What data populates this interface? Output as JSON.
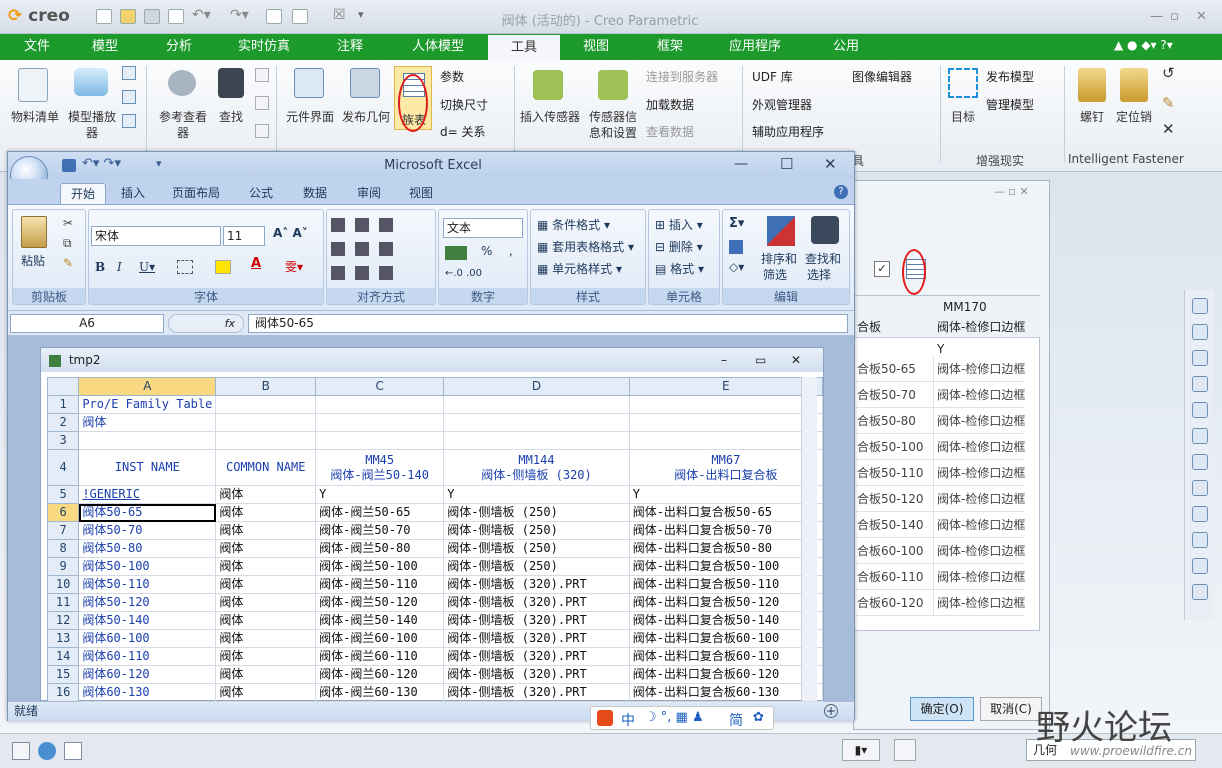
{
  "creo": {
    "logo": "creo",
    "window_title": "阀体 (活动的) - Creo Parametric",
    "tabs": [
      "文件",
      "模型",
      "分析",
      "实时仿真",
      "注释",
      "人体模型",
      "工具",
      "视图",
      "框架",
      "应用程序",
      "公用"
    ],
    "ribbon": {
      "bom": "物料清单",
      "model_player_1": "模型播放",
      "model_player_2": "器",
      "ref_viewer_1": "参考查看",
      "ref_viewer_2": "器",
      "find": "查找",
      "comp_interface": "元件界面",
      "publish_geom": "发布几何",
      "table": "族表",
      "params": "参数",
      "switch_dims": "切换尺寸",
      "relations": "d= 关系",
      "insert_sensor": "插入传感器",
      "sensor_info_1": "传感器信",
      "sensor_info_2": "息和设置",
      "connect_server": "连接到服务器",
      "load_data": "加载数据",
      "view_data": "查看数据",
      "udf_lib": "UDF 库",
      "appearance_mgr": "外观管理器",
      "aux_app": "辅助应用程序",
      "image_editor": "图像编辑器",
      "target": "目标",
      "publish_model": "发布模型",
      "manage_model": "管理模型",
      "ar_group": "增强现实",
      "bolt": "螺钉",
      "locate_pin": "定位销",
      "fastener_group": "Intelligent Fastener",
      "tool_group": "具"
    },
    "dialog": {
      "col1_partial": "合板",
      "col2_title": "MM170",
      "col2_sub": "阀体-检修口边框",
      "generic_val": "Y",
      "rows": [
        [
          "合板50-65",
          "阀体-检修口边框"
        ],
        [
          "合板50-70",
          "阀体-检修口边框"
        ],
        [
          "合板50-80",
          "阀体-检修口边框"
        ],
        [
          "合板50-100",
          "阀体-检修口边框"
        ],
        [
          "合板50-110",
          "阀体-检修口边框"
        ],
        [
          "合板50-120",
          "阀体-检修口边框"
        ],
        [
          "合板50-140",
          "阀体-检修口边框"
        ],
        [
          "合板60-100",
          "阀体-检修口边框"
        ],
        [
          "合板60-110",
          "阀体-检修口边框"
        ],
        [
          "合板60-120",
          "阀体-检修口边框"
        ]
      ],
      "ok": "确定(O)",
      "cancel": "取消(C)"
    },
    "status_right": "几何"
  },
  "excel": {
    "title": "Microsoft Excel",
    "tabs": [
      "开始",
      "插入",
      "页面布局",
      "公式",
      "数据",
      "审阅",
      "视图"
    ],
    "ribbon": {
      "paste": "粘贴",
      "clipboard": "剪贴板",
      "font_name": "宋体",
      "font_size": "11",
      "font_group": "字体",
      "align_group": "对齐方式",
      "number_format": "文本",
      "number_group": "数字",
      "cond_format": "条件格式",
      "table_format": "套用表格格式",
      "cell_style": "单元格样式",
      "style_group": "样式",
      "insert": "插入",
      "delete": "删除",
      "format": "格式",
      "cells_group": "单元格",
      "sort_1": "排序和",
      "sort_2": "筛选",
      "find_1": "查找和",
      "find_2": "选择",
      "edit_group": "编辑",
      "currency": "%"
    },
    "name_box": "A6",
    "formula": "阀体50-65",
    "status": "就绪",
    "sheet_title": "tmp2",
    "columns": [
      "A",
      "B",
      "C",
      "D",
      "E"
    ],
    "rows": [
      {
        "n": "1",
        "cells": [
          "Pro/E Family Table",
          "",
          "",
          "",
          ""
        ]
      },
      {
        "n": "2",
        "cells": [
          "阀体",
          "",
          "",
          "",
          ""
        ]
      },
      {
        "n": "3",
        "cells": [
          "",
          "",
          "",
          "",
          ""
        ]
      },
      {
        "n": "4",
        "cells": [
          "INST NAME",
          "COMMON NAME",
          "MM45\n阀体-阀兰50-140",
          "MM144\n阀体-侧墙板 (320)",
          "MM67\n阀体-出料口复合板"
        ]
      },
      {
        "n": "5",
        "cells": [
          "!GENERIC",
          "阀体",
          "Y",
          "Y",
          "Y"
        ]
      },
      {
        "n": "6",
        "cells": [
          "阀体50-65",
          "阀体",
          "阀体-阀兰50-65",
          "阀体-侧墙板 (250)",
          "阀体-出料口复合板50-65"
        ]
      },
      {
        "n": "7",
        "cells": [
          "阀体50-70",
          "阀体",
          "阀体-阀兰50-70",
          "阀体-侧墙板 (250)",
          "阀体-出料口复合板50-70"
        ]
      },
      {
        "n": "8",
        "cells": [
          "阀体50-80",
          "阀体",
          "阀体-阀兰50-80",
          "阀体-侧墙板 (250)",
          "阀体-出料口复合板50-80"
        ]
      },
      {
        "n": "9",
        "cells": [
          "阀体50-100",
          "阀体",
          "阀体-阀兰50-100",
          "阀体-侧墙板 (250)",
          "阀体-出料口复合板50-100"
        ]
      },
      {
        "n": "10",
        "cells": [
          "阀体50-110",
          "阀体",
          "阀体-阀兰50-110",
          "阀体-侧墙板 (320).PRT",
          "阀体-出料口复合板50-110"
        ]
      },
      {
        "n": "11",
        "cells": [
          "阀体50-120",
          "阀体",
          "阀体-阀兰50-120",
          "阀体-侧墙板 (320).PRT",
          "阀体-出料口复合板50-120"
        ]
      },
      {
        "n": "12",
        "cells": [
          "阀体50-140",
          "阀体",
          "阀体-阀兰50-140",
          "阀体-侧墙板 (320).PRT",
          "阀体-出料口复合板50-140"
        ]
      },
      {
        "n": "13",
        "cells": [
          "阀体60-100",
          "阀体",
          "阀体-阀兰60-100",
          "阀体-侧墙板 (320).PRT",
          "阀体-出料口复合板60-100"
        ]
      },
      {
        "n": "14",
        "cells": [
          "阀体60-110",
          "阀体",
          "阀体-阀兰60-110",
          "阀体-侧墙板 (320).PRT",
          "阀体-出料口复合板60-110"
        ]
      },
      {
        "n": "15",
        "cells": [
          "阀体60-120",
          "阀体",
          "阀体-阀兰60-120",
          "阀体-侧墙板 (320).PRT",
          "阀体-出料口复合板60-120"
        ]
      },
      {
        "n": "16",
        "cells": [
          "阀体60-130",
          "阀体",
          "阀体-阀兰60-130",
          "阀体-侧墙板 (320).PRT",
          "阀体-出料口复合板60-130"
        ]
      }
    ]
  },
  "ime": [
    "中",
    "简"
  ],
  "watermark": {
    "title": "野火论坛",
    "url": "www.proewildfire.cn"
  },
  "colors": {
    "creo_green": "#1c9a2c",
    "excel_blue": "#c9daf0",
    "highlight_red": "#e01b1b"
  }
}
